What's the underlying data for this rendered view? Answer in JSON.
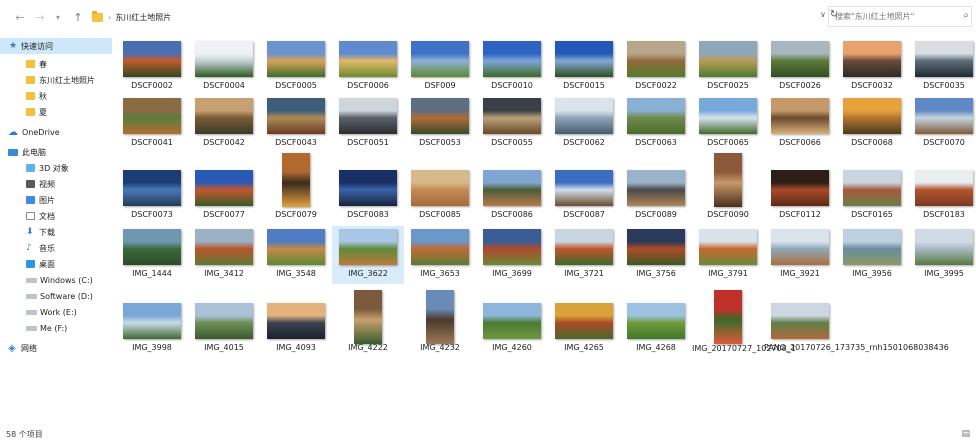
{
  "address": {
    "path_label": "东川红土地照片",
    "search_placeholder": "搜索\"东川红土地照片\""
  },
  "sidebar": {
    "items": [
      {
        "label": "快速访问",
        "icon": "star-icon",
        "selected": true
      },
      {
        "label": "春",
        "icon": "folder-icon"
      },
      {
        "label": "东川红土地照片",
        "icon": "folder-icon"
      },
      {
        "label": "秋",
        "icon": "folder-icon"
      },
      {
        "label": "夏",
        "icon": "folder-icon"
      },
      {
        "label": "OneDrive",
        "icon": "cloud-icon"
      },
      {
        "label": "此电脑",
        "icon": "computer-icon"
      },
      {
        "label": "3D 对象",
        "icon": "3d-objects-icon"
      },
      {
        "label": "视频",
        "icon": "video-icon"
      },
      {
        "label": "图片",
        "icon": "pictures-icon"
      },
      {
        "label": "文档",
        "icon": "documents-icon"
      },
      {
        "label": "下载",
        "icon": "download-icon"
      },
      {
        "label": "音乐",
        "icon": "music-icon"
      },
      {
        "label": "桌面",
        "icon": "desktop-icon"
      },
      {
        "label": "Windows (C:)",
        "icon": "drive-icon"
      },
      {
        "label": "Software (D:)",
        "icon": "drive-icon"
      },
      {
        "label": "Work (E:)",
        "icon": "drive-icon"
      },
      {
        "label": "Me (F:)",
        "icon": "drive-icon"
      },
      {
        "label": "网络",
        "icon": "network-icon"
      }
    ]
  },
  "files": [
    {
      "name": "DSCF0002",
      "colors": [
        "#4a6fb0",
        "#c45a2a",
        "#2f4a1e"
      ]
    },
    {
      "name": "DSCF0004",
      "colors": [
        "#eef2f4",
        "#c7d0d5",
        "#2d5a24"
      ]
    },
    {
      "name": "DSCF0005",
      "colors": [
        "#6b93cf",
        "#d8a35a",
        "#3d6b2a"
      ]
    },
    {
      "name": "DSCF0006",
      "colors": [
        "#5f8ad0",
        "#e2b96a",
        "#6c8a30"
      ]
    },
    {
      "name": "DSF009",
      "colors": [
        "#3f72c6",
        "#8fb0d8",
        "#5c8a2e"
      ]
    },
    {
      "name": "DSCF0010",
      "colors": [
        "#2d63c1",
        "#7ea6dc",
        "#3e6a26"
      ]
    },
    {
      "name": "DSCF0015",
      "colors": [
        "#2357b8",
        "#86a9d8",
        "#2d4f1f"
      ]
    },
    {
      "name": "DSCF0022",
      "colors": [
        "#b9a58c",
        "#8f6a3c",
        "#577a2c"
      ]
    },
    {
      "name": "DSCF0025",
      "colors": [
        "#8fa7b8",
        "#b99c57",
        "#4c7a31"
      ]
    },
    {
      "name": "DSCF0026",
      "colors": [
        "#a8b7bf",
        "#5e7b3b",
        "#2f4d20"
      ]
    },
    {
      "name": "DSCF0032",
      "colors": [
        "#e9a26d",
        "#6a4b38",
        "#2c2a26"
      ]
    },
    {
      "name": "DSCF0035",
      "colors": [
        "#d7dde2",
        "#5f6e7b",
        "#1f2a33"
      ]
    },
    {
      "name": "DSCF0041",
      "colors": [
        "#8a6b44",
        "#5a7e3a",
        "#b56b34"
      ]
    },
    {
      "name": "DSCF0042",
      "colors": [
        "#c6a070",
        "#7a5a34",
        "#3b3b2a"
      ]
    },
    {
      "name": "DSCF0043",
      "colors": [
        "#3d5d7a",
        "#b08a55",
        "#6a3b24"
      ]
    },
    {
      "name": "DSCF0051",
      "colors": [
        "#cfd6db",
        "#59626a",
        "#2a2e33"
      ]
    },
    {
      "name": "DSCF0053",
      "colors": [
        "#5b6f80",
        "#b16b3a",
        "#3a4a2a"
      ]
    },
    {
      "name": "DSCF0055",
      "colors": [
        "#3a3f45",
        "#b9a07a",
        "#6b4a2a"
      ]
    },
    {
      "name": "DSCF0062",
      "colors": [
        "#d9e4ec",
        "#8fa6b8",
        "#485e70"
      ]
    },
    {
      "name": "DSCF0063",
      "colors": [
        "#8ab0d6",
        "#6f8a4a",
        "#4b6b2f"
      ]
    },
    {
      "name": "DSCF0065",
      "colors": [
        "#79a8dc",
        "#d6e3ee",
        "#406a2c"
      ]
    },
    {
      "name": "DSCF0066",
      "colors": [
        "#c49a6a",
        "#6d4a2c",
        "#d8b07a"
      ],
      "portrait": false
    },
    {
      "name": "DSCF0068",
      "colors": [
        "#e7a23b",
        "#b3752e",
        "#4a3a24"
      ]
    },
    {
      "name": "DSCF0070",
      "colors": [
        "#5f89c4",
        "#c7d4e0",
        "#7d5a38"
      ]
    },
    {
      "name": "DSCF0073",
      "colors": [
        "#1d3e74",
        "#4a78b8",
        "#243b5a"
      ]
    },
    {
      "name": "DSCF0077",
      "colors": [
        "#2b5ab4",
        "#c4562e",
        "#3a5a26"
      ]
    },
    {
      "name": "DSCF0079",
      "colors": [
        "#b06a2e",
        "#3a2a1e",
        "#e2a23c"
      ],
      "portrait": true
    },
    {
      "name": "DSCF0083",
      "colors": [
        "#1a2f66",
        "#3c63a8",
        "#16233c"
      ]
    },
    {
      "name": "DSCF0085",
      "colors": [
        "#d8b98a",
        "#c48a55",
        "#a86a3a"
      ]
    },
    {
      "name": "DSCF0086",
      "colors": [
        "#7fa7d4",
        "#4a5e36",
        "#b87a4a"
      ]
    },
    {
      "name": "DSCF0087",
      "colors": [
        "#3b6ec2",
        "#d2dfeb",
        "#6a4a2c"
      ]
    },
    {
      "name": "DSCF0089",
      "colors": [
        "#9bb3c9",
        "#4a4a4a",
        "#b08656"
      ]
    },
    {
      "name": "DSCF0090",
      "colors": [
        "#8a5a3a",
        "#c7986a",
        "#4a2e1e"
      ],
      "portrait": true
    },
    {
      "name": "DSCF0112",
      "colors": [
        "#2d1f18",
        "#a84a26",
        "#5a2a16"
      ]
    },
    {
      "name": "DSCF0165",
      "colors": [
        "#c9d6df",
        "#a85a3a",
        "#6a7e48"
      ]
    },
    {
      "name": "DSCF0183",
      "colors": [
        "#e8eef2",
        "#b3542e",
        "#7a3a22"
      ]
    },
    {
      "name": "IMG_1444",
      "colors": [
        "#6f98b0",
        "#3a6a3a",
        "#2f4a28"
      ]
    },
    {
      "name": "IMG_3412",
      "colors": [
        "#9ab2c4",
        "#b8552a",
        "#5f7a36"
      ]
    },
    {
      "name": "IMG_3548",
      "colors": [
        "#4f7cc2",
        "#c58a4a",
        "#5c8a34"
      ],
      "portrait": false
    },
    {
      "name": "IMG_3622",
      "colors": [
        "#a9c6e6",
        "#5f8a3a",
        "#c07a3a"
      ],
      "selected": true
    },
    {
      "name": "IMG_3653",
      "colors": [
        "#6c97c9",
        "#c16a36",
        "#5a7c34"
      ]
    },
    {
      "name": "IMG_3699",
      "colors": [
        "#3a5d95",
        "#b04a2a",
        "#6a8a3a"
      ]
    },
    {
      "name": "IMG_3721",
      "colors": [
        "#c9d6df",
        "#c0552a",
        "#3f6a2a"
      ]
    },
    {
      "name": "IMG_3756",
      "colors": [
        "#2a3a5a",
        "#b04a26",
        "#3a5a26"
      ]
    },
    {
      "name": "IMG_3791",
      "colors": [
        "#d9e2ea",
        "#c8682e",
        "#6a8a3a"
      ]
    },
    {
      "name": "IMG_3921",
      "colors": [
        "#d8e3ec",
        "#8ea8b8",
        "#a8703e"
      ]
    },
    {
      "name": "IMG_3956",
      "colors": [
        "#bcd0e0",
        "#6c8aa0",
        "#8a9a62"
      ]
    },
    {
      "name": "IMG_3995",
      "colors": [
        "#cfdbe5",
        "#a8b8c2",
        "#5a7a40"
      ]
    },
    {
      "name": "IMG_3998",
      "colors": [
        "#7aa8d6",
        "#c9dbe8",
        "#3f6a32"
      ]
    },
    {
      "name": "IMG_4015",
      "colors": [
        "#a9c2d6",
        "#6f8f56",
        "#3a5a2c"
      ]
    },
    {
      "name": "IMG_4093",
      "colors": [
        "#e4b27a",
        "#3a4250",
        "#1a2230"
      ]
    },
    {
      "name": "IMG_4222",
      "colors": [
        "#7a5a3a",
        "#c8a070",
        "#3a5a2a"
      ],
      "portrait": true
    },
    {
      "name": "IMG_4232",
      "colors": [
        "#6a8ab8",
        "#4a3a2a",
        "#9a7a5a"
      ],
      "portrait": true
    },
    {
      "name": "IMG_4260",
      "colors": [
        "#8fb5dc",
        "#4a7a32",
        "#6d9a3e"
      ]
    },
    {
      "name": "IMG_4265",
      "colors": [
        "#d9a23a",
        "#a84a26",
        "#4a6a2a"
      ]
    },
    {
      "name": "IMG_4268",
      "colors": [
        "#9ec2e0",
        "#6f9a3a",
        "#3f7a2a"
      ]
    },
    {
      "name": "IMG_20170727_102708_1",
      "colors": [
        "#c0302a",
        "#3a6a2a",
        "#e05a3a"
      ],
      "portrait": true
    },
    {
      "name": "PANO_20170726_173735_rnh1501068038436",
      "colors": [
        "#cbd8e3",
        "#5f7f4a",
        "#b06a3a"
      ]
    }
  ],
  "status": {
    "item_count": "58 个项目"
  }
}
